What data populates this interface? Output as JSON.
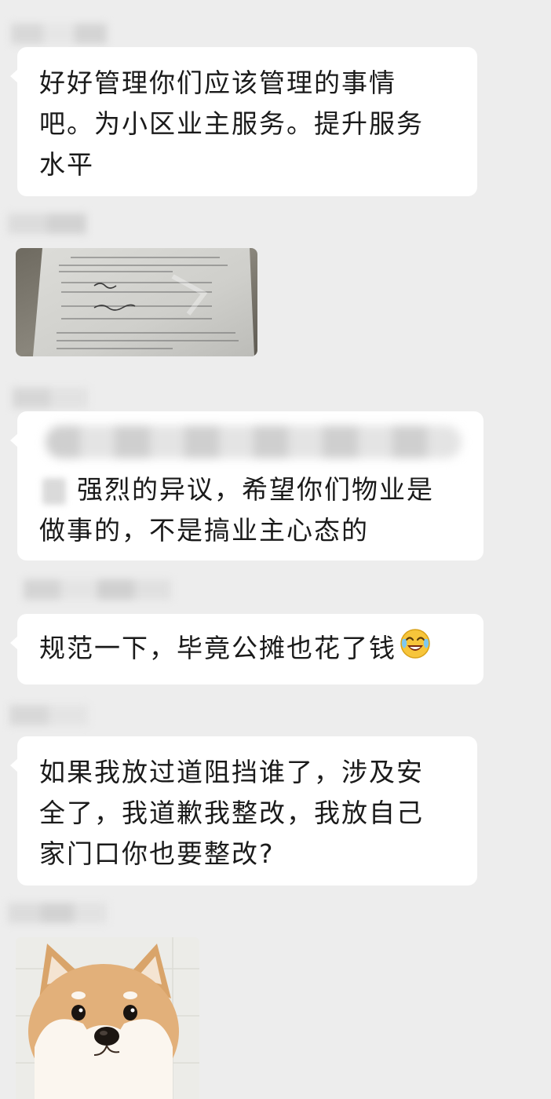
{
  "messages": [
    {
      "type": "text",
      "lines": [
        "好好管理你们应该管理的事情",
        "吧。为小区业主服务。提升服务",
        "水平"
      ]
    },
    {
      "type": "image",
      "icon": "paper-notice-photo"
    },
    {
      "type": "text",
      "quoted": true,
      "lines": [
        "强烈的异议，希望你们物业是",
        "做事的，不是搞业主心态的"
      ]
    },
    {
      "type": "text",
      "lines": [
        "规范一下，毕竟公摊也花了钱"
      ],
      "emoji": "laughing-crying-emoji"
    },
    {
      "type": "text",
      "lines": [
        "如果我放过道阻挡谁了，涉及安",
        "全了，我道歉我整改，我放自己",
        "家门口你也要整改?"
      ]
    },
    {
      "type": "image",
      "icon": "shiba-dog-sticker"
    }
  ],
  "colors": {
    "background": "#ededed",
    "bubble": "#ffffff",
    "text": "#1a1a1a"
  }
}
